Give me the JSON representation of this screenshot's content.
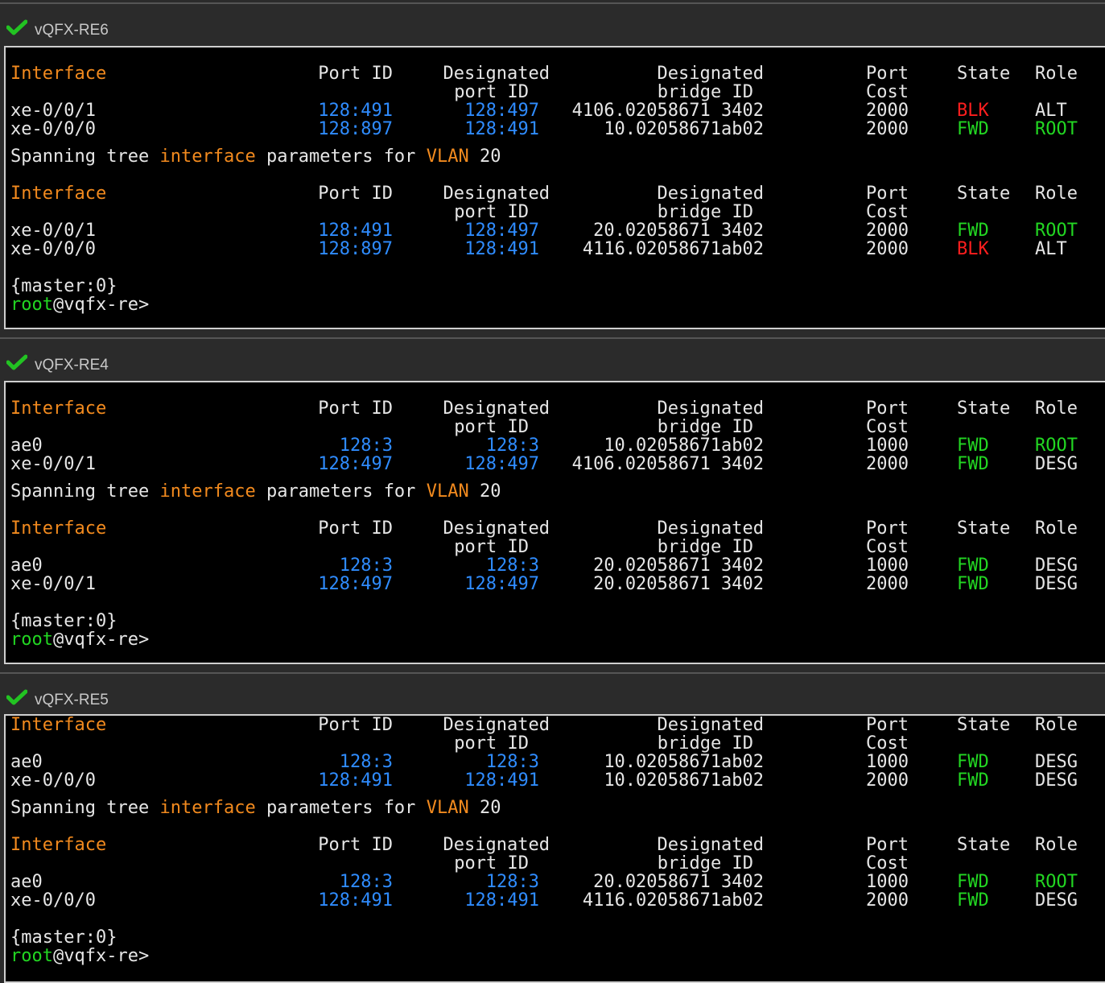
{
  "panels": [
    {
      "title": "vQFX-RE6",
      "tables": [
        {
          "rows": [
            {
              "iface": "xe-0/0/1",
              "port_id": "128:491",
              "des_port": "128:497",
              "des_bridge": "4106.02058671 3402",
              "cost": "2000",
              "state": "BLK",
              "role": "ALT"
            },
            {
              "iface": "xe-0/0/0",
              "port_id": "128:897",
              "des_port": "128:491",
              "des_bridge": "10.02058671ab02",
              "cost": "2000",
              "state": "FWD",
              "role": "ROOT"
            }
          ]
        },
        {
          "rows": [
            {
              "iface": "xe-0/0/1",
              "port_id": "128:491",
              "des_port": "128:497",
              "des_bridge": "20.02058671 3402",
              "cost": "2000",
              "state": "FWD",
              "role": "ROOT"
            },
            {
              "iface": "xe-0/0/0",
              "port_id": "128:897",
              "des_port": "128:491",
              "des_bridge": "4116.02058671ab02",
              "cost": "2000",
              "state": "BLK",
              "role": "ALT"
            }
          ]
        }
      ]
    },
    {
      "title": "vQFX-RE4",
      "tables": [
        {
          "rows": [
            {
              "iface": "ae0",
              "port_id": "128:3",
              "des_port": "128:3",
              "des_bridge": "10.02058671ab02",
              "cost": "1000",
              "state": "FWD",
              "role": "ROOT"
            },
            {
              "iface": "xe-0/0/1",
              "port_id": "128:497",
              "des_port": "128:497",
              "des_bridge": "4106.02058671 3402",
              "cost": "2000",
              "state": "FWD",
              "role": "DESG"
            }
          ]
        },
        {
          "rows": [
            {
              "iface": "ae0",
              "port_id": "128:3",
              "des_port": "128:3",
              "des_bridge": "20.02058671 3402",
              "cost": "1000",
              "state": "FWD",
              "role": "DESG"
            },
            {
              "iface": "xe-0/0/1",
              "port_id": "128:497",
              "des_port": "128:497",
              "des_bridge": "20.02058671 3402",
              "cost": "2000",
              "state": "FWD",
              "role": "DESG"
            }
          ]
        }
      ]
    },
    {
      "title": "vQFX-RE5",
      "tables": [
        {
          "rows": [
            {
              "iface": "ae0",
              "port_id": "128:3",
              "des_port": "128:3",
              "des_bridge": "10.02058671ab02",
              "cost": "1000",
              "state": "FWD",
              "role": "DESG"
            },
            {
              "iface": "xe-0/0/0",
              "port_id": "128:491",
              "des_port": "128:491",
              "des_bridge": "10.02058671ab02",
              "cost": "2000",
              "state": "FWD",
              "role": "DESG"
            }
          ]
        },
        {
          "rows": [
            {
              "iface": "ae0",
              "port_id": "128:3",
              "des_port": "128:3",
              "des_bridge": "20.02058671 3402",
              "cost": "1000",
              "state": "FWD",
              "role": "ROOT"
            },
            {
              "iface": "xe-0/0/0",
              "port_id": "128:491",
              "des_port": "128:491",
              "des_bridge": "4116.02058671ab02",
              "cost": "2000",
              "state": "FWD",
              "role": "DESG"
            }
          ]
        }
      ]
    }
  ],
  "headers": {
    "interface": "Interface",
    "port_id": "Port ID",
    "designated": "Designated",
    "port_id_2": "port ID",
    "bridge_id_2": "bridge ID",
    "port": "Port",
    "cost": "Cost",
    "state": "State",
    "role": "Role"
  },
  "vlan_line": {
    "w1": "Spanning tree ",
    "w2": "interface",
    "w3": " parameters for ",
    "w4": "VLAN",
    "w5": " 20"
  },
  "prompt": {
    "master": "{master:0}",
    "user": "root",
    "host": "@vqfx-re>"
  },
  "colors": {
    "orange": "#f28a1e",
    "blue": "#2f8cff",
    "green": "#22d622",
    "red": "#ff1e1e",
    "check": "#22c322"
  }
}
